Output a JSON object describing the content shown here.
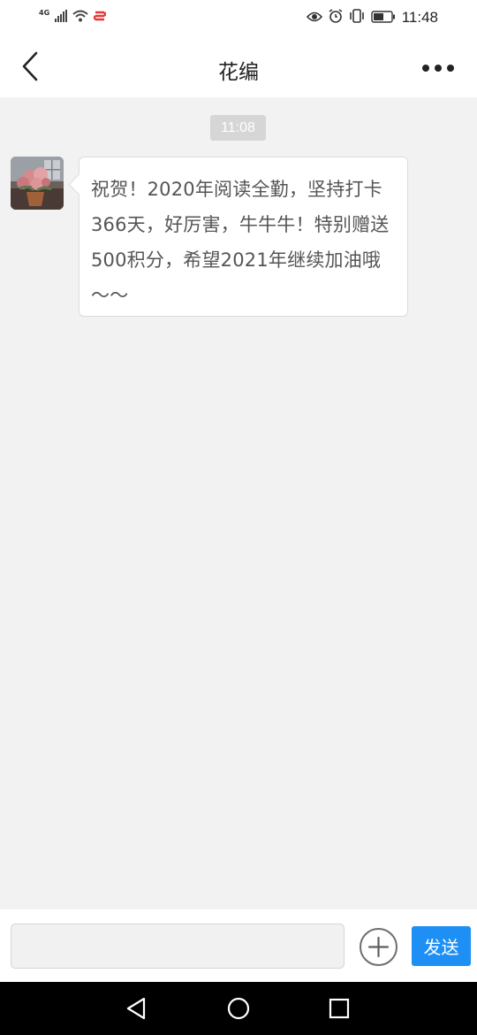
{
  "status_bar": {
    "network_label": "4G",
    "time": "11:48",
    "icons": [
      "signal-icon",
      "wifi-icon",
      "app-notification-icon",
      "eye-icon",
      "alarm-icon",
      "vibrate-icon",
      "battery-icon"
    ]
  },
  "nav": {
    "title": "花编",
    "back_icon": "chevron-left-icon",
    "more_icon": "more-dots-icon"
  },
  "chat": {
    "timestamp": "11:08",
    "messages": [
      {
        "sender_avatar": "flower-avatar",
        "text": "祝贺！2020年阅读全勤，坚持打卡366天，好厉害，牛牛牛！特别赠送500积分，希望2021年继续加油哦～～"
      }
    ]
  },
  "composer": {
    "input_value": "",
    "input_placeholder": "",
    "plus_icon": "plus-circle-icon",
    "send_label": "发送"
  },
  "system_nav": {
    "icons": [
      "back-triangle-icon",
      "home-circle-icon",
      "recents-square-icon"
    ]
  },
  "colors": {
    "accent": "#1e8ff5",
    "background": "#f2f2f2",
    "bubble": "#ffffff",
    "timestamp_badge": "#d6d6d6"
  }
}
